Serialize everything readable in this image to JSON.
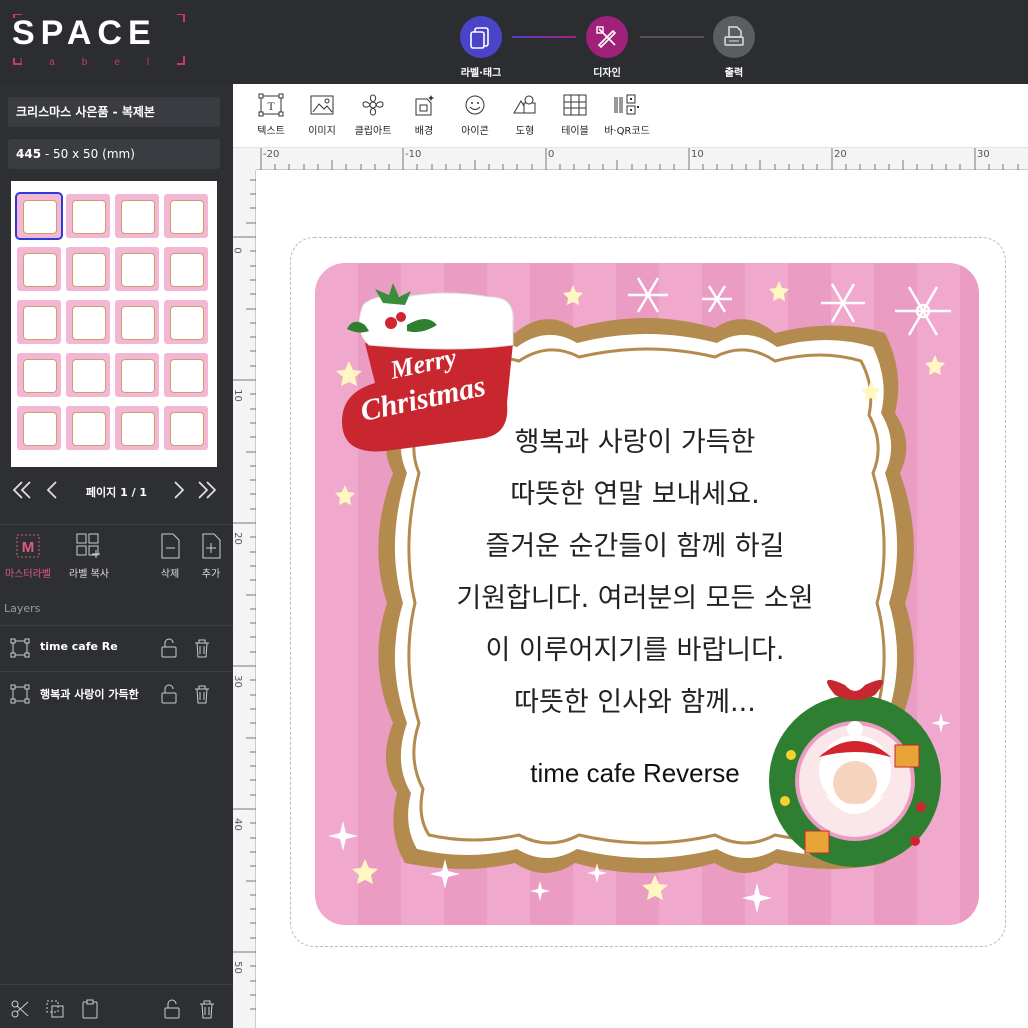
{
  "app": {
    "logo_main": "SPACE",
    "logo_sub": "label"
  },
  "steps": [
    {
      "label": "라벨·태그",
      "color": "#4a44c8"
    },
    {
      "label": "디자인",
      "color": "#a1207a"
    },
    {
      "label": "출력",
      "color": "#5b5d62"
    }
  ],
  "project": {
    "name": "크리스마스 사은품 - 복제본",
    "size_code": "445",
    "size_text": "50 x 50 (mm)"
  },
  "pager": {
    "text": "페이지 1 / 1"
  },
  "left_tools": {
    "master": "마스터라벨",
    "copy": "라벨 복사",
    "delete": "삭제",
    "add": "추가"
  },
  "layers": {
    "title": "Layers",
    "items": [
      {
        "name": "time cafe Re"
      },
      {
        "name": "행복과 사랑이 가득한"
      }
    ]
  },
  "toolbar": {
    "text": "텍스트",
    "image": "이미지",
    "clipart": "클립아트",
    "background": "배경",
    "icon": "아이콘",
    "shape": "도형",
    "table": "테이블",
    "barcode": "바·QR코드"
  },
  "ruler": {
    "h": [
      "-20",
      "-10",
      "0",
      "10",
      "20",
      "30"
    ],
    "v": [
      "0",
      "10",
      "20",
      "30",
      "40",
      "50"
    ]
  },
  "design": {
    "lines": [
      "행복과 사랑이 가득한",
      "따뜻한 연말 보내세요.",
      "즐거운 순간들이 함께 하길",
      "기원합니다. 여러분의 모든 소원",
      "이 이루어지기를 바랍니다.",
      "따뜻한 인사와 함께..."
    ],
    "signature": "time cafe Reverse",
    "stocking_line1": "Merry",
    "stocking_line2": "Christmas",
    "colors": {
      "pink": "#f0a9cd",
      "frame": "#b48b4f"
    }
  }
}
